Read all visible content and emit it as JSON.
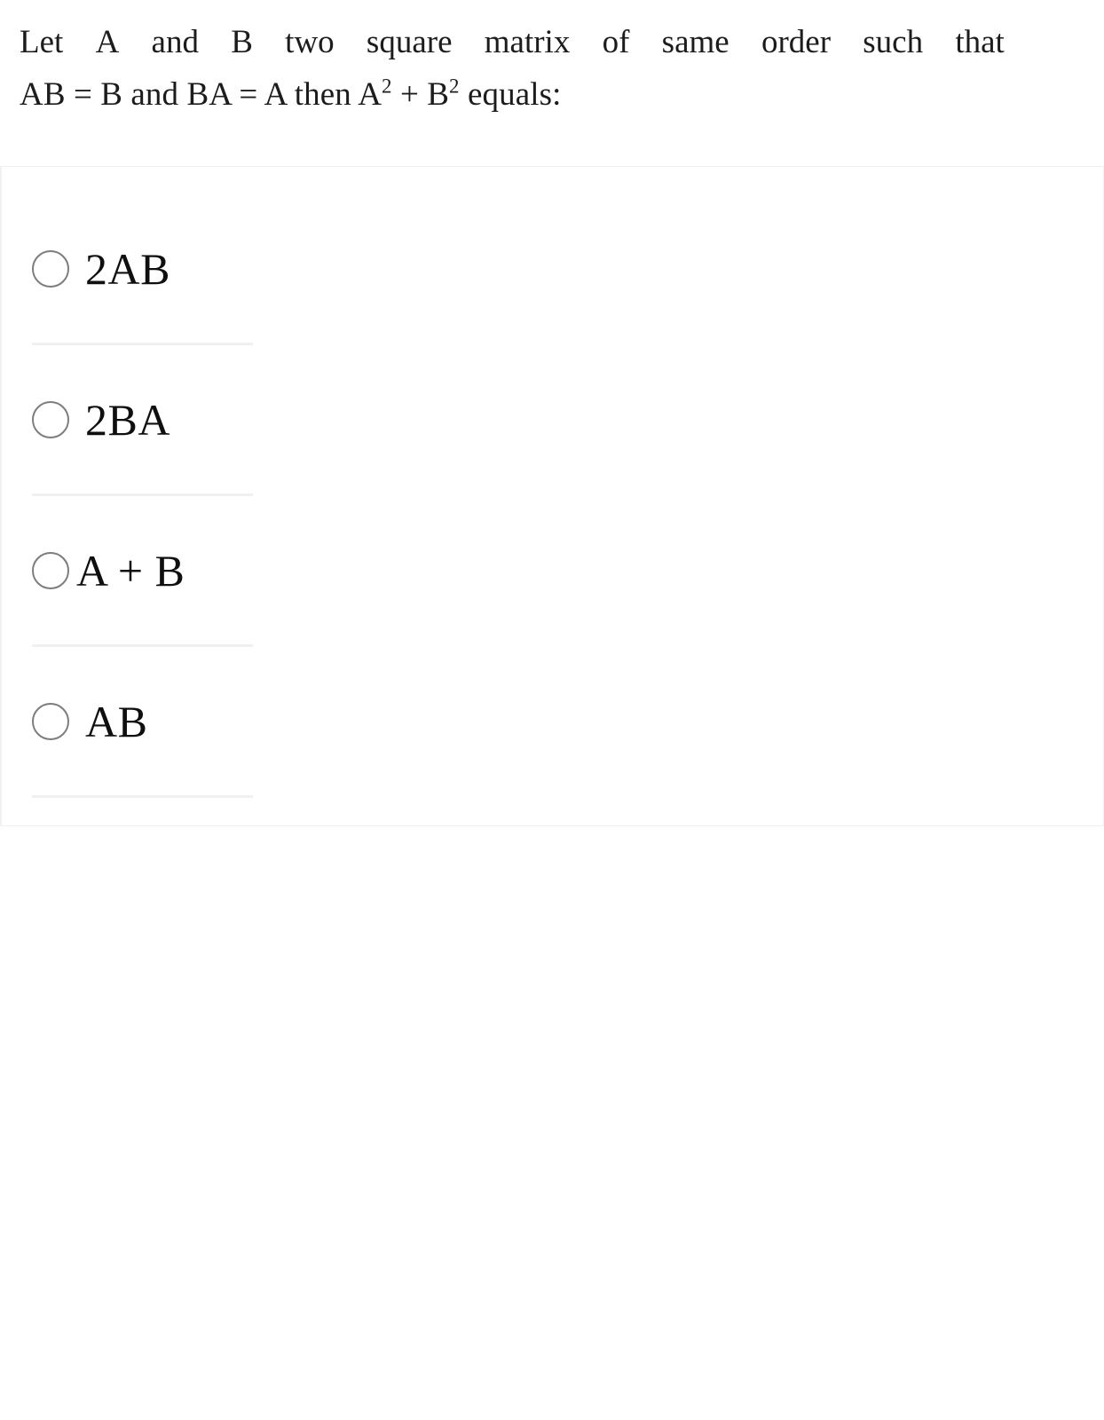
{
  "question": {
    "line1_words": [
      "Let",
      "A",
      "and",
      "B",
      "two",
      "square",
      "matrix",
      "of",
      "same",
      "order",
      "such",
      "that"
    ],
    "line2_prefix": "AB = B and BA = A then A",
    "line2_sup1": "2",
    "line2_mid": " + B",
    "line2_sup2": "2",
    "line2_suffix": " equals:",
    "full_text": "Let A and B two square matrix of same order such that AB = B and BA = A then A2 + B2 equals:"
  },
  "options": [
    {
      "id": "option-a",
      "label": "2AB",
      "selected": false
    },
    {
      "id": "option-b",
      "label": "2BA",
      "selected": false
    },
    {
      "id": "option-c",
      "label": "A + B",
      "selected": false
    },
    {
      "id": "option-d",
      "label": "AB",
      "selected": false
    }
  ],
  "colors": {
    "text": "#1c1c1c",
    "option_text": "#0f0f0f",
    "radio_border": "#7d7d7d",
    "divider": "#eef0f2",
    "card_border": "#f0f0f2",
    "background": "#ffffff"
  }
}
